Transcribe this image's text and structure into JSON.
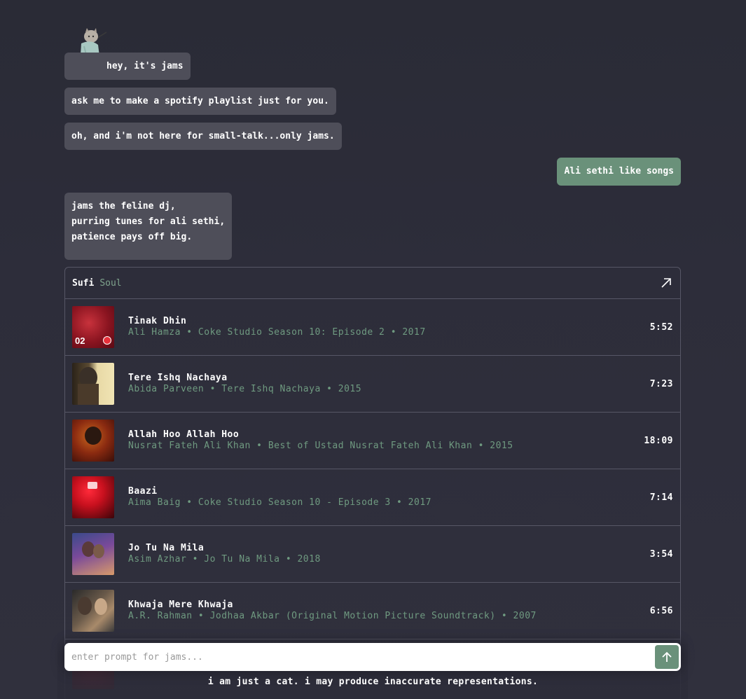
{
  "messages": [
    {
      "role": "bot",
      "text": "hey, it's jams"
    },
    {
      "role": "bot",
      "text": "ask me to make a spotify playlist just for you."
    },
    {
      "role": "bot",
      "text": "oh, and i'm not here for small-talk...only jams."
    },
    {
      "role": "user",
      "text": "Ali sethi like songs"
    },
    {
      "role": "bot",
      "text": "jams the feline dj,\npurring tunes for ali sethi,\npatience pays off big."
    }
  ],
  "playlist": {
    "title_first": "Sufi",
    "title_second": "Soul",
    "open_icon": "arrow-up-right-icon",
    "tracks": [
      {
        "name": "Tinak Dhin",
        "details": "Ali Hamza • Coke Studio Season 10: Episode 2 • 2017",
        "duration": "5:52",
        "cover_label": "02"
      },
      {
        "name": "Tere Ishq Nachaya",
        "details": "Abida Parveen • Tere Ishq Nachaya • 2015",
        "duration": "7:23",
        "cover_label": ""
      },
      {
        "name": "Allah Hoo Allah Hoo",
        "details": "Nusrat Fateh Ali Khan • Best of Ustad Nusrat Fateh Ali Khan • 2015",
        "duration": "18:09",
        "cover_label": ""
      },
      {
        "name": "Baazi",
        "details": "Aima Baig • Coke Studio Season 10 - Episode 3 • 2017",
        "duration": "7:14",
        "cover_label": ""
      },
      {
        "name": "Jo Tu Na Mila",
        "details": "Asim Azhar • Jo Tu Na Mila • 2018",
        "duration": "3:54",
        "cover_label": ""
      },
      {
        "name": "Khwaja Mere Khwaja",
        "details": "A.R. Rahman • Jodhaa Akbar (Original Motion Picture Soundtrack) • 2007",
        "duration": "6:56",
        "cover_label": ""
      }
    ]
  },
  "prompt": {
    "placeholder": "enter prompt for jams...",
    "send_icon": "arrow-up-icon"
  },
  "footer": {
    "note": "i am just a cat. i may produce inaccurate representations."
  },
  "colors": {
    "accent": "#6a917a",
    "bot_bubble": "#4e4e59",
    "subtext": "#6f9a80"
  }
}
